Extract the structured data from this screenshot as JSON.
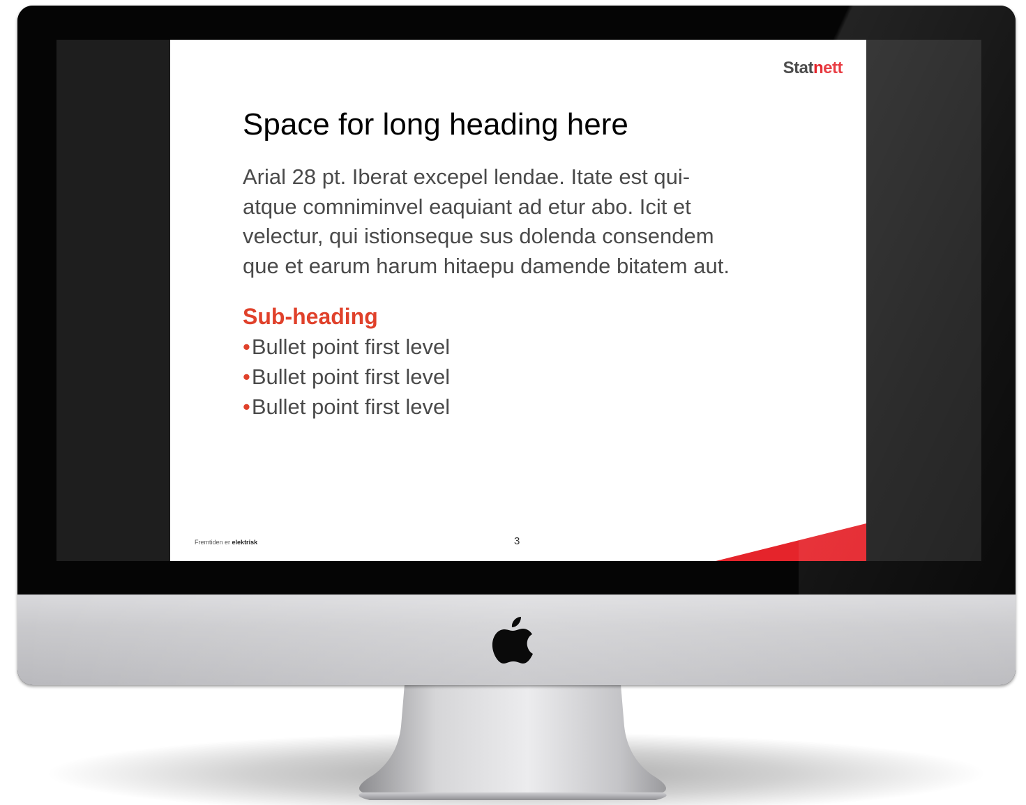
{
  "slide": {
    "brand_part1": "Stat",
    "brand_part2": "nett",
    "title": "Space for long heading here",
    "body_lines": [
      "Arial 28 pt. Iberat excepel lendae. Itate est qui-",
      "atque comniminvel eaquiant ad etur abo. Icit et",
      "velectur, qui istionseque sus dolenda consendem",
      "que et earum harum hitaepu damende bitatem aut."
    ],
    "subheading": "Sub-heading",
    "bullet_symbol": "•",
    "bullets": [
      "Bullet point first level",
      "Bullet point first level",
      "Bullet point first level"
    ],
    "footer_prefix": "Fremtiden er",
    "footer_bold": "elektrisk",
    "page_number": "3"
  },
  "colors": {
    "accent_red": "#e5242b",
    "subheading_red": "#e0412b",
    "body_gray": "#4a4a4a",
    "brand_gray": "#4d4d4d"
  },
  "icons": {
    "chin_logo": "apple-logo-icon"
  }
}
